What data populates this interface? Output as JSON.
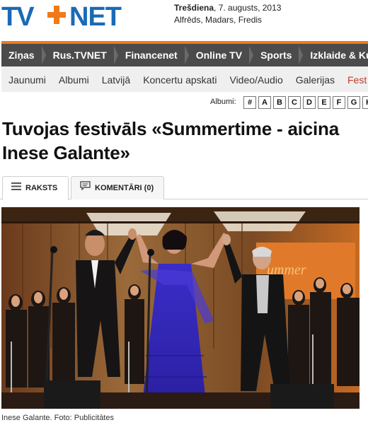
{
  "header": {
    "logo_text": "TV3NET",
    "weekday": "Trešdiena",
    "date": ", 7. augusts, 2013",
    "names": "Alfrēds, Madars, Fredis"
  },
  "main_nav": [
    "Ziņas",
    "Rus.TVNET",
    "Financenet",
    "Online TV",
    "Sports",
    "Izklaide & Kult"
  ],
  "sub_nav": [
    "Jaunumi",
    "Albumi",
    "Latvijā",
    "Koncertu apskati",
    "Video/Audio",
    "Galerijas",
    "Fest"
  ],
  "albumi": {
    "label": "Albumi:",
    "letters": [
      "#",
      "A",
      "B",
      "C",
      "D",
      "E",
      "F",
      "G",
      "H"
    ]
  },
  "article": {
    "title": "Tuvojas festivāls «Summertime - aicina Inese Galante»",
    "tabs": {
      "articles": "RAKSTS",
      "comments": "KOMENTĀRI (0)"
    },
    "photo_caption": "Inese Galante. Foto: Publicitātes"
  },
  "colors": {
    "accent_orange": "#f07a1a",
    "nav_bg": "#4b4b4b",
    "subnav_bg": "#efefef",
    "active_subnav": "#c0392b",
    "logo_blue": "#1a6ab5"
  }
}
